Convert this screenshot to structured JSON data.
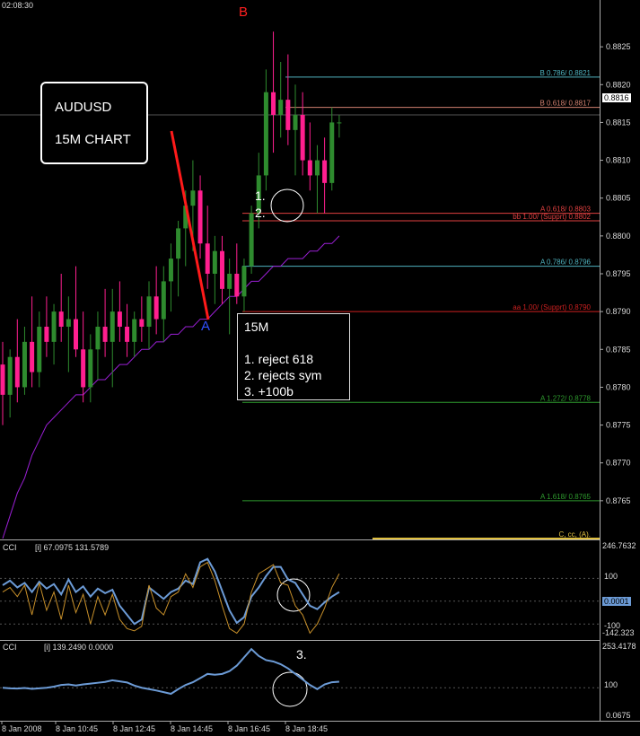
{
  "time_label": "02:08:30",
  "title_box": {
    "symbol": "AUDUSD",
    "timeframe": "15M CHART"
  },
  "notes_box": {
    "title": "15M",
    "items": [
      "1. reject 618",
      "2. rejects sym",
      "3. +100b"
    ]
  },
  "point_labels": {
    "a": "A",
    "b": "B"
  },
  "touch_labels": [
    "1.",
    "2.",
    "3."
  ],
  "price_tag": "0.8816",
  "colors": {
    "bg": "#000000",
    "bull": "#2e8b2e",
    "bear": "#ff1f8f",
    "ma": "#9b1fd6",
    "cci_main": "#6c9bd6",
    "cci_sig": "#c8902a"
  },
  "cci1": {
    "label": "CCI",
    "params": "[i] 67.0975 131.5789",
    "max_label": "246.7632",
    "ticks": [
      "100",
      "-100"
    ],
    "min_label": "-142.323",
    "current_label": "0.0001"
  },
  "cci2": {
    "label": "CCI",
    "params": "[i] 139.2490 0.0000",
    "max_label": "253.4178",
    "ticks": [
      "100"
    ],
    "min_label": "0.0675"
  },
  "chart_data": [
    {
      "type": "candlestick",
      "symbol": "AUDUSD",
      "timeframe": "15M",
      "ylim": [
        0.876,
        0.883
      ],
      "y_ticks": [
        "0.8825",
        "0.8820",
        "0.8815",
        "0.8810",
        "0.8805",
        "0.8800",
        "0.8795",
        "0.8790",
        "0.8785",
        "0.8780",
        "0.8775",
        "0.8770",
        "0.8765"
      ],
      "x_ticks": [
        "8 Jan 2008",
        "8 Jan 10:45",
        "8 Jan 12:45",
        "8 Jan 14:45",
        "8 Jan 16:45",
        "8 Jan 18:45"
      ],
      "candles": [
        {
          "o": 0.8783,
          "h": 0.8786,
          "l": 0.8775,
          "c": 0.8779
        },
        {
          "o": 0.8779,
          "h": 0.8785,
          "l": 0.8776,
          "c": 0.8784
        },
        {
          "o": 0.8784,
          "h": 0.8789,
          "l": 0.8778,
          "c": 0.878
        },
        {
          "o": 0.878,
          "h": 0.8788,
          "l": 0.8779,
          "c": 0.8786
        },
        {
          "o": 0.8786,
          "h": 0.8792,
          "l": 0.878,
          "c": 0.8782
        },
        {
          "o": 0.8782,
          "h": 0.879,
          "l": 0.878,
          "c": 0.8788
        },
        {
          "o": 0.8788,
          "h": 0.8792,
          "l": 0.8784,
          "c": 0.8786
        },
        {
          "o": 0.8786,
          "h": 0.8791,
          "l": 0.8783,
          "c": 0.879
        },
        {
          "o": 0.879,
          "h": 0.8795,
          "l": 0.8786,
          "c": 0.8788
        },
        {
          "o": 0.8788,
          "h": 0.8792,
          "l": 0.8782,
          "c": 0.8789
        },
        {
          "o": 0.8789,
          "h": 0.8796,
          "l": 0.8784,
          "c": 0.8785
        },
        {
          "o": 0.8785,
          "h": 0.879,
          "l": 0.8778,
          "c": 0.878
        },
        {
          "o": 0.878,
          "h": 0.8787,
          "l": 0.8778,
          "c": 0.8785
        },
        {
          "o": 0.8785,
          "h": 0.879,
          "l": 0.8781,
          "c": 0.8788
        },
        {
          "o": 0.8788,
          "h": 0.8793,
          "l": 0.8784,
          "c": 0.8786
        },
        {
          "o": 0.8786,
          "h": 0.8793,
          "l": 0.878,
          "c": 0.879
        },
        {
          "o": 0.879,
          "h": 0.8794,
          "l": 0.8786,
          "c": 0.8788
        },
        {
          "o": 0.8788,
          "h": 0.8791,
          "l": 0.8784,
          "c": 0.8786
        },
        {
          "o": 0.8786,
          "h": 0.879,
          "l": 0.8784,
          "c": 0.8789
        },
        {
          "o": 0.8789,
          "h": 0.8792,
          "l": 0.8786,
          "c": 0.8788
        },
        {
          "o": 0.8788,
          "h": 0.8794,
          "l": 0.8785,
          "c": 0.8792
        },
        {
          "o": 0.8792,
          "h": 0.8796,
          "l": 0.8787,
          "c": 0.8789
        },
        {
          "o": 0.8789,
          "h": 0.8796,
          "l": 0.8786,
          "c": 0.8794
        },
        {
          "o": 0.8794,
          "h": 0.8799,
          "l": 0.879,
          "c": 0.8797
        },
        {
          "o": 0.8797,
          "h": 0.8802,
          "l": 0.8792,
          "c": 0.8801
        },
        {
          "o": 0.8801,
          "h": 0.8806,
          "l": 0.8796,
          "c": 0.8804
        },
        {
          "o": 0.8804,
          "h": 0.881,
          "l": 0.8798,
          "c": 0.8806
        },
        {
          "o": 0.8806,
          "h": 0.8808,
          "l": 0.8797,
          "c": 0.8799
        },
        {
          "o": 0.8799,
          "h": 0.8804,
          "l": 0.8793,
          "c": 0.8795
        },
        {
          "o": 0.8795,
          "h": 0.88,
          "l": 0.8791,
          "c": 0.8798
        },
        {
          "o": 0.8798,
          "h": 0.88,
          "l": 0.8791,
          "c": 0.8793
        },
        {
          "o": 0.8793,
          "h": 0.8797,
          "l": 0.8787,
          "c": 0.8795
        },
        {
          "o": 0.8795,
          "h": 0.8799,
          "l": 0.8791,
          "c": 0.8792
        },
        {
          "o": 0.8792,
          "h": 0.8797,
          "l": 0.879,
          "c": 0.8796
        },
        {
          "o": 0.8796,
          "h": 0.8804,
          "l": 0.8795,
          "c": 0.8803
        },
        {
          "o": 0.8803,
          "h": 0.8811,
          "l": 0.8801,
          "c": 0.8808
        },
        {
          "o": 0.8808,
          "h": 0.8822,
          "l": 0.8806,
          "c": 0.8819
        },
        {
          "o": 0.8819,
          "h": 0.8827,
          "l": 0.8811,
          "c": 0.8816
        },
        {
          "o": 0.8816,
          "h": 0.8823,
          "l": 0.8813,
          "c": 0.8818
        },
        {
          "o": 0.8818,
          "h": 0.8824,
          "l": 0.8812,
          "c": 0.8814
        },
        {
          "o": 0.8814,
          "h": 0.882,
          "l": 0.8808,
          "c": 0.8816
        },
        {
          "o": 0.8816,
          "h": 0.8819,
          "l": 0.8808,
          "c": 0.881
        },
        {
          "o": 0.881,
          "h": 0.8815,
          "l": 0.8806,
          "c": 0.8808
        },
        {
          "o": 0.8808,
          "h": 0.8812,
          "l": 0.8803,
          "c": 0.881
        },
        {
          "o": 0.881,
          "h": 0.8813,
          "l": 0.8803,
          "c": 0.8807
        },
        {
          "o": 0.8807,
          "h": 0.8817,
          "l": 0.8806,
          "c": 0.8815
        },
        {
          "o": 0.8815,
          "h": 0.8816,
          "l": 0.8813,
          "c": 0.8815
        }
      ],
      "moving_average": [
        0.876,
        0.8763,
        0.8766,
        0.8768,
        0.8771,
        0.8773,
        0.8775,
        0.8776,
        0.8777,
        0.8778,
        0.8779,
        0.8779,
        0.878,
        0.8781,
        0.8781,
        0.8782,
        0.8783,
        0.8783,
        0.8784,
        0.8785,
        0.8785,
        0.8786,
        0.8786,
        0.8787,
        0.8787,
        0.8788,
        0.8788,
        0.8789,
        0.8789,
        0.879,
        0.8791,
        0.8792,
        0.8792,
        0.8793,
        0.8794,
        0.8794,
        0.8795,
        0.8796,
        0.8796,
        0.8797,
        0.8797,
        0.8797,
        0.8798,
        0.8798,
        0.8799,
        0.8799,
        0.88
      ],
      "levels": [
        {
          "label": "B 0.786/ 0.8821",
          "value": 0.8821,
          "color": "#4fb3bf"
        },
        {
          "label": "B 0.618/ 0.8817",
          "value": 0.8817,
          "color": "#d08070"
        },
        {
          "label": "A 0.618/ 0.8803",
          "value": 0.8803,
          "color": "#e04040"
        },
        {
          "label": "bb 1.00/ (Supprt) 0.8802",
          "value": 0.8802,
          "color": "#e04040"
        },
        {
          "label": "A 0.786/ 0.8796",
          "value": 0.8796,
          "color": "#4fb3bf"
        },
        {
          "label": "aa 1.00/ (Supprt) 0.8790",
          "value": 0.879,
          "color": "#cc2020"
        },
        {
          "label": "A 1.272/ 0.8778",
          "value": 0.8778,
          "color": "#2e9b2e"
        },
        {
          "label": "A 1.618/ 0.8765",
          "value": 0.8765,
          "color": "#2e9b2e"
        },
        {
          "label": "C, cc, (A).",
          "value": 0.876,
          "color": "#e0c040"
        }
      ]
    },
    {
      "type": "line",
      "name": "CCI",
      "ylim": [
        -142.323,
        246.7632
      ],
      "series": [
        {
          "values": [
            70,
            90,
            60,
            80,
            40,
            85,
            55,
            75,
            30,
            95,
            40,
            65,
            20,
            55,
            35,
            50,
            -20,
            -60,
            -100,
            -80,
            60,
            35,
            10,
            40,
            55,
            90,
            75,
            170,
            185,
            130,
            45,
            -40,
            -95,
            -70,
            20,
            60,
            110,
            150,
            150,
            95,
            80,
            30,
            -20,
            -35,
            -5,
            20,
            40
          ]
        },
        {
          "values": [
            40,
            60,
            20,
            70,
            -60,
            80,
            -40,
            40,
            -80,
            70,
            -50,
            30,
            -100,
            20,
            -60,
            30,
            -80,
            -120,
            -130,
            -110,
            70,
            -30,
            -60,
            20,
            40,
            120,
            60,
            150,
            170,
            90,
            -20,
            -120,
            -140,
            -100,
            40,
            120,
            140,
            160,
            80,
            70,
            -20,
            -60,
            -140,
            -100,
            -30,
            60,
            120
          ]
        }
      ]
    },
    {
      "type": "line",
      "name": "CCI",
      "ylim": [
        0.0675,
        253.4178
      ],
      "series": [
        {
          "values": [
            100,
            98,
            97,
            99,
            96,
            98,
            100,
            104,
            110,
            112,
            108,
            112,
            115,
            118,
            121,
            127,
            123,
            119,
            108,
            100,
            95,
            90,
            84,
            78,
            95,
            110,
            120,
            135,
            150,
            147,
            150,
            160,
            180,
            210,
            240,
            215,
            200,
            195,
            185,
            170,
            150,
            130,
            110,
            95,
            112,
            120,
            122
          ]
        }
      ]
    }
  ]
}
